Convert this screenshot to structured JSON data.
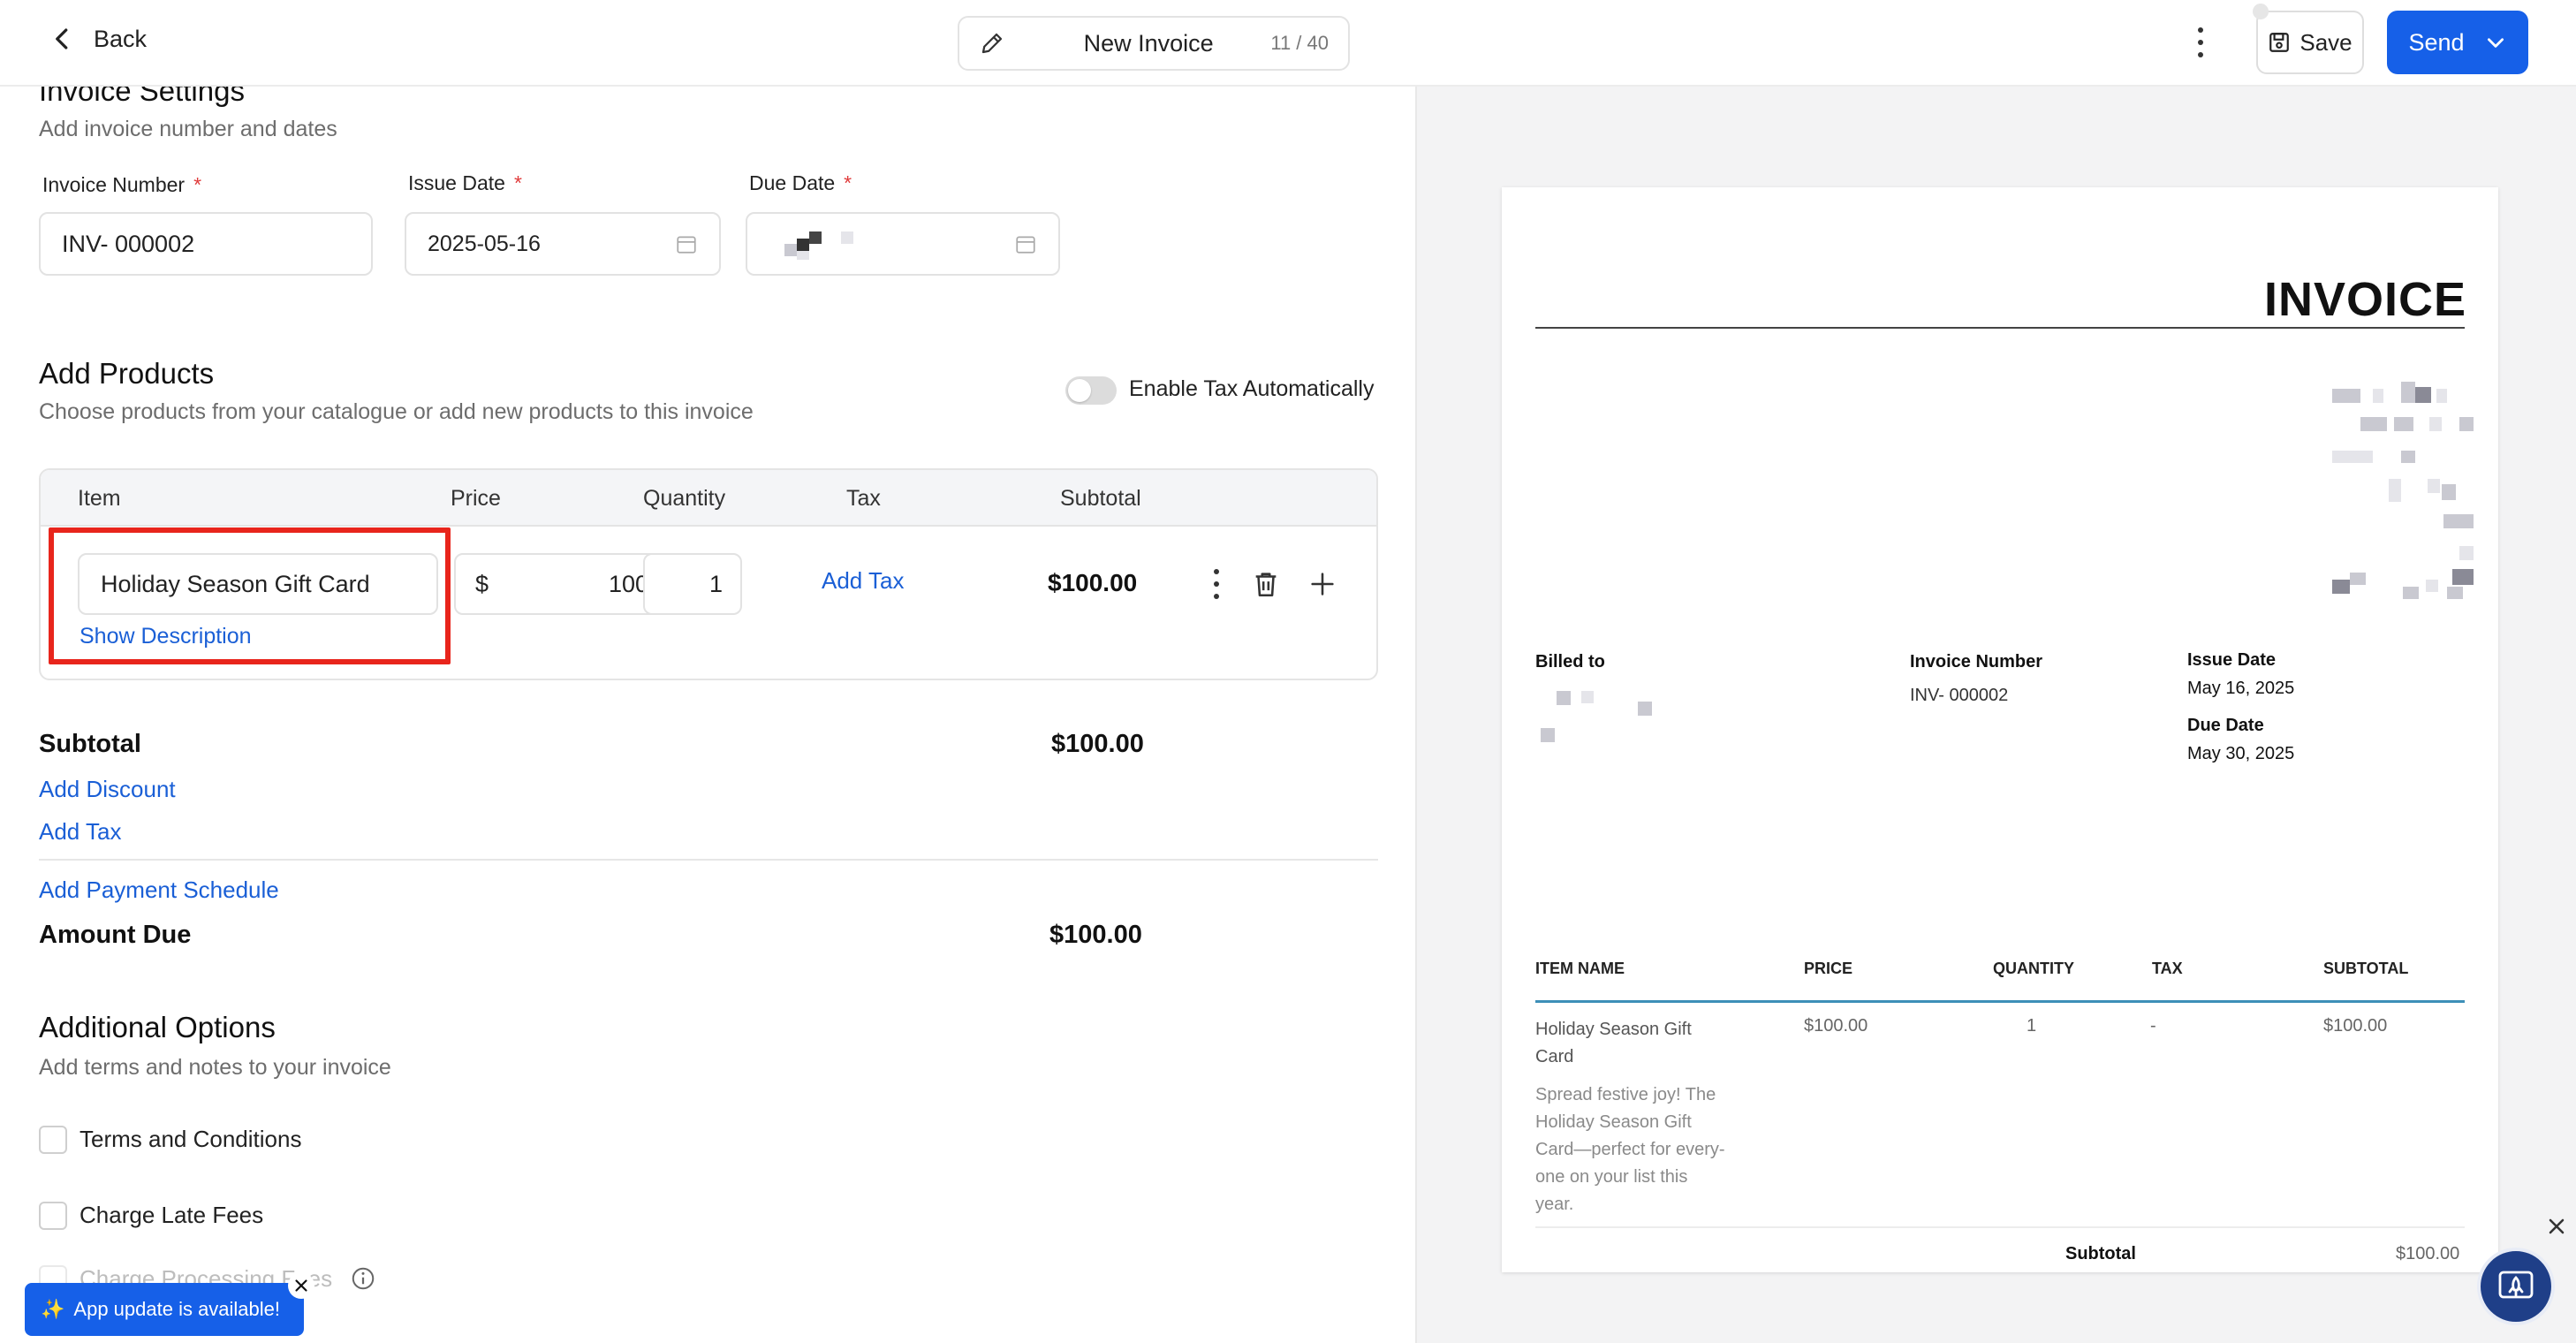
{
  "header": {
    "back_label": "Back",
    "title": "New Invoice",
    "char_count": "11 / 40",
    "save_label": "Save",
    "send_label": "Send"
  },
  "invoice_settings": {
    "title": "Invoice Settings",
    "subtitle": "Add invoice number and dates",
    "invoice_number_label": "Invoice Number",
    "invoice_number_value": "INV- 000002",
    "issue_date_label": "Issue Date",
    "issue_date_value": "2025-05-16",
    "due_date_label": "Due Date",
    "required_mark": "*"
  },
  "products": {
    "title": "Add Products",
    "subtitle": "Choose products from your catalogue or add new products to this invoice",
    "tax_toggle_label": "Enable Tax Automatically",
    "tax_toggle_on": false,
    "columns": [
      "Item",
      "Price",
      "Quantity",
      "Tax",
      "Subtotal"
    ],
    "row": {
      "item": "Holiday Season Gift Card",
      "currency": "$",
      "price": "100",
      "quantity": "1",
      "add_tax": "Add Tax",
      "subtotal": "$100.00",
      "show_description": "Show Description"
    }
  },
  "totals": {
    "subtotal_label": "Subtotal",
    "subtotal_value": "$100.00",
    "add_discount": "Add Discount",
    "add_tax": "Add Tax",
    "add_payment_schedule": "Add Payment Schedule",
    "amount_due_label": "Amount Due",
    "amount_due_value": "$100.00"
  },
  "additional": {
    "title": "Additional Options",
    "subtitle": "Add terms and notes to your invoice",
    "options": [
      "Terms and Conditions",
      "Charge Late Fees",
      "Charge Processing Fees"
    ]
  },
  "toast": {
    "icon": "✨",
    "text": "App update is available!"
  },
  "preview": {
    "title": "INVOICE",
    "billed_to_label": "Billed to",
    "invoice_number_label": "Invoice Number",
    "invoice_number_value": "INV- 000002",
    "issue_date_label": "Issue Date",
    "issue_date_value": "May 16, 2025",
    "due_date_label": "Due Date",
    "due_date_value": "May 30, 2025",
    "columns": [
      "ITEM NAME",
      "PRICE",
      "QUANTITY",
      "TAX",
      "SUBTOTAL"
    ],
    "item": {
      "name_line1": "Holiday Season Gift",
      "name_line2": "Card",
      "desc_lines": [
        "Spread festive joy! The",
        "Holiday Season Gift",
        "Card—perfect for every-",
        "one on your list this",
        "year."
      ],
      "price": "$100.00",
      "quantity": "1",
      "tax": "-",
      "subtotal": "$100.00"
    },
    "subtotal_label": "Subtotal",
    "subtotal_value": "$100.00"
  },
  "colors": {
    "accent": "#1660e8",
    "link": "#1a5fd6",
    "required": "#e03b3b",
    "highlight": "#e8251c"
  }
}
